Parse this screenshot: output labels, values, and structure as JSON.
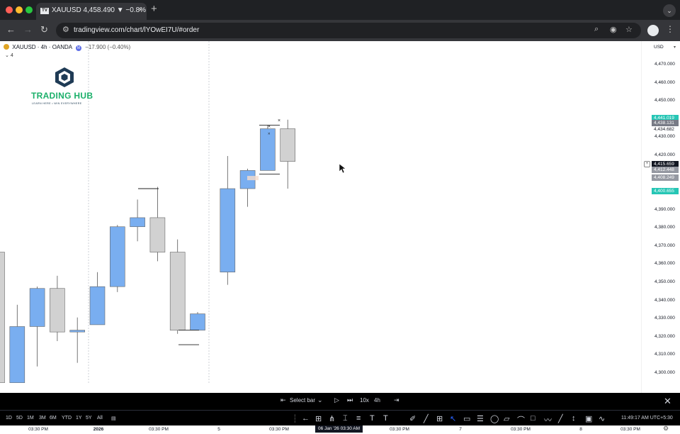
{
  "browser": {
    "tab_title": "XAUUSD 4,458.490 ▼ −0.8%",
    "tab_close": "×",
    "tab_logo": "TV",
    "new_tab": "+",
    "url": "tradingview.com/chart/lYOwEI7U/#order",
    "traffic_lights": [
      "#ff5f57",
      "#febc2e",
      "#28c840"
    ],
    "icons": [
      "back-arrow-icon",
      "forward-arrow-icon",
      "reload-icon",
      "site-settings-icon",
      "zoom-icon",
      "eye-icon",
      "bookmark-star-icon",
      "profile-avatar-icon",
      "kebab-menu-icon",
      "tab-search-icon"
    ]
  },
  "chart_header": {
    "symbol": "XAUUSD · 4h · OANDA",
    "market_badge": "M",
    "change": "−17.900 (−0.40%)",
    "indicators_collapsed": "4"
  },
  "logo": {
    "title": "TRADING HUB",
    "subtitle": "LEARN HERE • WIN EVERYWHERE"
  },
  "price_axis": {
    "currency": "USD",
    "labels": [
      "4,470.000",
      "4,460.000",
      "4,450.000",
      "4,430.000",
      "4,420.000",
      "4,390.000",
      "4,380.000",
      "4,370.000",
      "4,360.000",
      "4,350.000",
      "4,340.000",
      "4,330.000",
      "4,320.000",
      "4,310.000",
      "4,300.000"
    ],
    "tags": [
      {
        "price": 4441.019,
        "text": "4,441.019",
        "bg": "#26c6b5",
        "fg": "#ffffff"
      },
      {
        "price": 4438.131,
        "text": "4,438.131",
        "bg": "#787b86",
        "fg": "#ffffff"
      },
      {
        "price": 4434.682,
        "text": "4,434.682",
        "bg": "#ffffff",
        "fg": "#131722"
      },
      {
        "price": 4415.659,
        "text": "4,415.659",
        "bg": "#131722",
        "fg": "#ffffff"
      },
      {
        "price": 4412.448,
        "text": "4,412.448",
        "bg": "#9598a1",
        "fg": "#ffffff"
      },
      {
        "price": 4408.249,
        "text": "4,408.249",
        "bg": "#9598a1",
        "fg": "#ffffff"
      },
      {
        "price": 4400.655,
        "text": "4,400.655",
        "bg": "#26c6b5",
        "fg": "#ffffff"
      }
    ]
  },
  "time_axis": {
    "labels": [
      "03:30 PM",
      "2026",
      "03:30 PM",
      "5",
      "03:30 PM",
      "03:30 PM",
      "7",
      "03:30 PM",
      "8",
      "03:30 PM"
    ],
    "cursor_label": "06 Jan '26  03:30 AM"
  },
  "chart_data": {
    "type": "candlestick",
    "symbol": "XAUUSD",
    "timeframe": "4h",
    "exchange": "OANDA",
    "ylim": [
      4296,
      4478
    ],
    "bull_color": "#79aef0",
    "bear_color": "#d1d1d1",
    "candles": [
      {
        "i": 0,
        "o": 4367,
        "h": 4367,
        "c": 4295,
        "l": 4295
      },
      {
        "i": 1,
        "o": 4295,
        "h": 4338,
        "c": 4326,
        "l": 4295
      },
      {
        "i": 2,
        "o": 4326,
        "h": 4348,
        "c": 4347,
        "l": 4304
      },
      {
        "i": 3,
        "o": 4347,
        "h": 4354,
        "c": 4323,
        "l": 4318
      },
      {
        "i": 4,
        "o": 4323,
        "h": 4331,
        "c": 4324,
        "l": 4306
      },
      {
        "i": 5,
        "o": 4327,
        "h": 4356,
        "c": 4348,
        "l": 4327
      },
      {
        "i": 6,
        "o": 4348,
        "h": 4382,
        "c": 4381,
        "l": 4345
      },
      {
        "i": 7,
        "o": 4381,
        "h": 4396,
        "c": 4386,
        "l": 4373
      },
      {
        "i": 8,
        "o": 4386,
        "h": 4403,
        "c": 4367,
        "l": 4362
      },
      {
        "i": 9,
        "o": 4367,
        "h": 4374,
        "c": 4324,
        "l": 4322
      },
      {
        "i": 10,
        "o": 4324,
        "h": 4334,
        "c": 4333,
        "l": 4324
      },
      {
        "i": 11,
        "o": 4356,
        "h": 4420,
        "c": 4402,
        "l": 4349
      },
      {
        "i": 12,
        "o": 4402,
        "h": 4413,
        "c": 4412,
        "l": 4392
      },
      {
        "i": 13,
        "o": 4412,
        "h": 4437,
        "c": 4435,
        "l": 4412
      },
      {
        "i": 14,
        "o": 4435,
        "h": 4440,
        "c": 4417,
        "l": 4402
      }
    ],
    "dashed_vlines": [
      "2026",
      "5"
    ]
  },
  "replay_bar": {
    "select_bar": "Select bar",
    "speed": "10x",
    "interval": "4h"
  },
  "bottom_bar": {
    "ranges": [
      "1D",
      "5D",
      "1M",
      "3M",
      "6M",
      "YTD",
      "1Y",
      "5Y",
      "All"
    ],
    "clock": "11:49:17 AM UTC+5:30"
  }
}
